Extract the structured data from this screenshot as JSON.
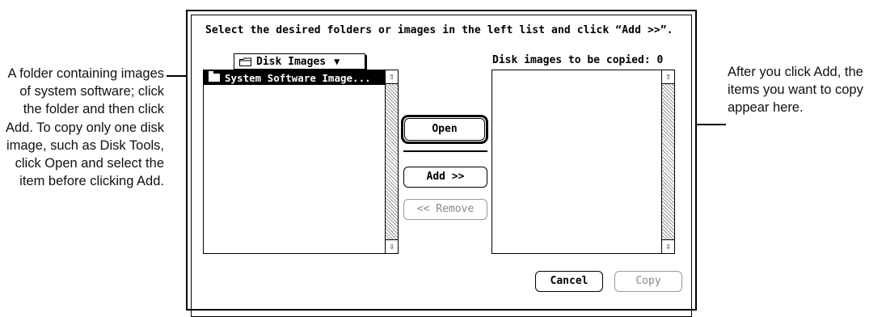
{
  "callouts": {
    "left": "A folder containing images of system software; click the folder and then click Add. To copy only one disk image, such as Disk Tools, click Open and select the item before clicking Add.",
    "right": "After you click Add, the items you want to copy appear here."
  },
  "dialog": {
    "instruction": "Select the desired folders or images in the left list and click “Add >>”.",
    "folder_popup": {
      "label": "Disk Images",
      "icon": "folder-icon",
      "arrow": "▼"
    },
    "copy_count_label": "Disk images to be copied: 0",
    "left_list": {
      "items": [
        {
          "label": "System Software Image...",
          "icon": "folder-icon",
          "selected": true
        }
      ]
    },
    "right_list": {
      "items": []
    },
    "buttons": {
      "open": "Open",
      "add": "Add >>",
      "remove": "<< Remove",
      "cancel": "Cancel",
      "copy": "Copy"
    },
    "scroll_up_glyph": "⇧",
    "scroll_down_glyph": "⇩"
  }
}
